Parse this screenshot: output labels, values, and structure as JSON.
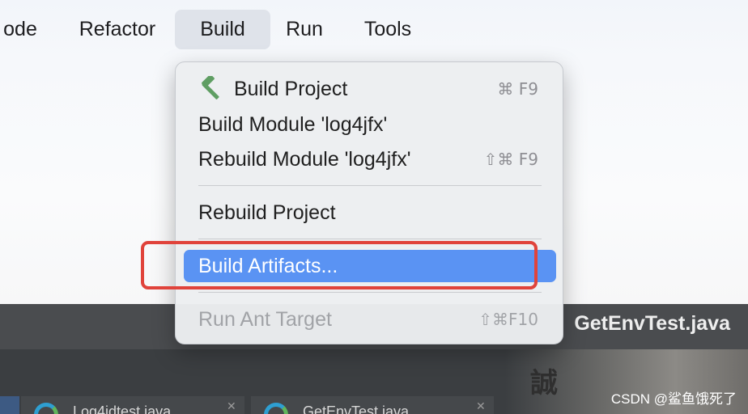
{
  "menubar": {
    "items": [
      "ode",
      "Refactor",
      "Build",
      "Run",
      "Tools"
    ],
    "active_index": 2
  },
  "editor": {
    "file_title": "GetEnvTest.java",
    "background_glyph": "誠",
    "tabs": [
      {
        "label": "Log4jdtest.java"
      },
      {
        "label": "GetEnvTest.java"
      }
    ]
  },
  "build_menu": {
    "items": [
      {
        "label": "Build Project",
        "shortcut": "⌘ F9",
        "icon": "hammer-icon"
      },
      {
        "label": "Build Module 'log4jfx'",
        "shortcut": ""
      },
      {
        "label": "Rebuild Module 'log4jfx'",
        "shortcut": "⇧⌘ F9"
      },
      {
        "label": "Rebuild Project",
        "shortcut": ""
      },
      {
        "label": "Build Artifacts...",
        "shortcut": "",
        "state": "highlighted"
      },
      {
        "label": "Run Ant Target",
        "shortcut": "⇧⌘F10",
        "state": "disabled"
      }
    ]
  },
  "watermark": "CSDN @鲨鱼饿死了",
  "colors": {
    "highlight": "#5a93f3",
    "annotation": "#e0433b",
    "hammer": "#5f9e63"
  }
}
